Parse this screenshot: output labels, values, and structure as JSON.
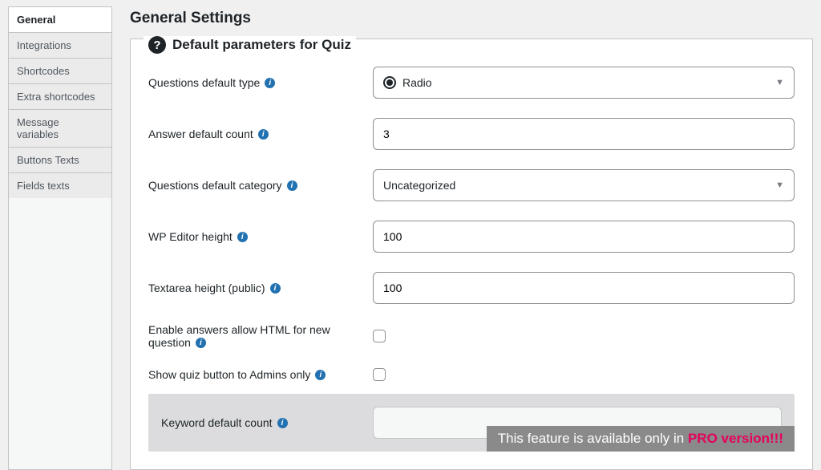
{
  "page_title": "General Settings",
  "sidebar": {
    "items": [
      {
        "label": "General",
        "active": true
      },
      {
        "label": "Integrations",
        "active": false
      },
      {
        "label": "Shortcodes",
        "active": false
      },
      {
        "label": "Extra shortcodes",
        "active": false
      },
      {
        "label": "Message variables",
        "active": false
      },
      {
        "label": "Buttons Texts",
        "active": false
      },
      {
        "label": "Fields texts",
        "active": false
      }
    ]
  },
  "panel": {
    "legend": "Default parameters for Quiz",
    "fields": {
      "q_type_label": "Questions default type",
      "q_type_value": "Radio",
      "ans_count_label": "Answer default count",
      "ans_count_value": "3",
      "q_cat_label": "Questions default category",
      "q_cat_value": "Uncategorized",
      "wp_editor_label": "WP Editor height",
      "wp_editor_value": "100",
      "textarea_label": "Textarea height (public)",
      "textarea_value": "100",
      "allow_html_label_1": "Enable answers allow HTML for new",
      "allow_html_label_2": "question",
      "admins_only_label": "Show quiz button to Admins only",
      "keyword_label": "Keyword default count"
    },
    "pro_notice_prefix": "This feature is available only in ",
    "pro_notice_bold": "PRO version!!!"
  },
  "info_char": "i"
}
